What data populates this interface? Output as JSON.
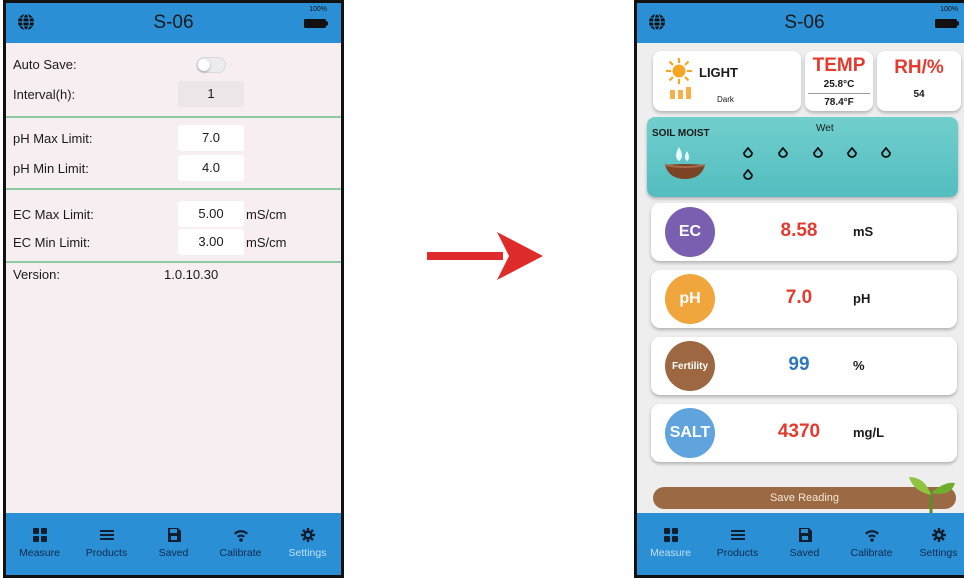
{
  "left": {
    "title": "S-06",
    "battery_label": "100%",
    "settings": {
      "auto_save_label": "Auto Save:",
      "interval_label": "Interval(h):",
      "interval_value": "1",
      "ph_max_label": "pH Max Limit:",
      "ph_max_value": "7.0",
      "ph_min_label": "pH Min Limit:",
      "ph_min_value": "4.0",
      "ec_max_label": "EC Max Limit:",
      "ec_max_value": "5.00",
      "ec_min_label": "EC Min Limit:",
      "ec_min_value": "3.00",
      "ec_unit": "mS/cm",
      "version_label": "Version:",
      "version_value": "1.0.10.30"
    }
  },
  "right": {
    "title": "S-06",
    "battery_label": "100%",
    "light": {
      "label": "LIGHT",
      "level_text": "Dark"
    },
    "temp": {
      "label": "TEMP",
      "celsius": "25.8°C",
      "fahrenheit": "78.4°F"
    },
    "rh": {
      "label": "RH/%",
      "value": "54"
    },
    "soil": {
      "label": "SOIL MOIST",
      "level_text": "Wet"
    },
    "metrics": [
      {
        "badge": "EC",
        "value": "8.58",
        "unit": "mS",
        "badge_color": "#7a5fb0",
        "value_color": "#e53b2f"
      },
      {
        "badge": "pH",
        "value": "7.0",
        "unit": "pH",
        "badge_color": "#f0a63c",
        "value_color": "#e53b2f"
      },
      {
        "badge": "Fertility",
        "value": "99",
        "unit": "%",
        "badge_color": "#9d6741",
        "value_color": "#2f76c0"
      },
      {
        "badge": "SALT",
        "value": "4370",
        "unit": "mg/L",
        "badge_color": "#5fa4dc",
        "value_color": "#e53b2f"
      }
    ],
    "save_button": "Save Reading"
  },
  "tabs": [
    {
      "label": "Measure",
      "icon": "grid-icon"
    },
    {
      "label": "Products",
      "icon": "list-icon"
    },
    {
      "label": "Saved",
      "icon": "save-icon"
    },
    {
      "label": "Calibrate",
      "icon": "wifi-icon"
    },
    {
      "label": "Settings",
      "icon": "gear-icon"
    }
  ],
  "colors": {
    "accent": "#2b8fd6",
    "divider": "#8cc9a0",
    "arrow": "#e02b2b",
    "alert_red": "#e53b2f"
  }
}
